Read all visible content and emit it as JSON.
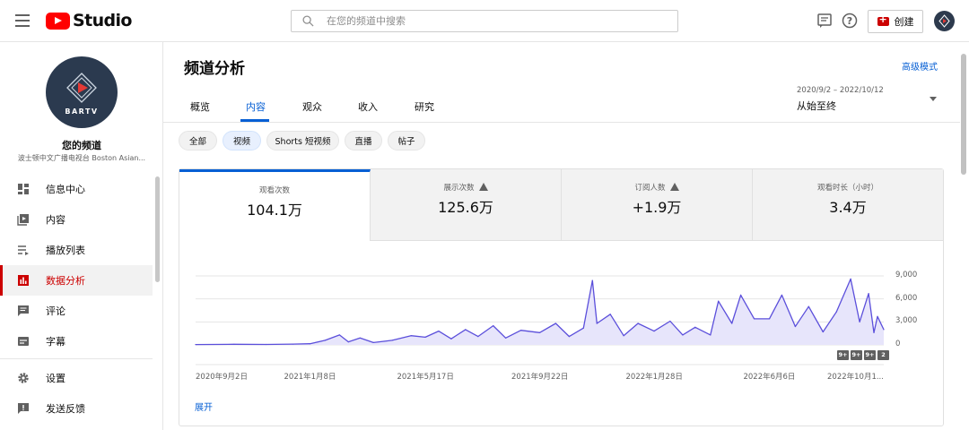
{
  "app": {
    "brand": "Studio",
    "search_placeholder": "在您的频道中搜索",
    "create_label": "创建"
  },
  "sidebar": {
    "channel_title": "您的频道",
    "channel_subtitle": "波士顿中文广播电视台 Boston Asian...",
    "avatar_text": "BARTV",
    "items": [
      {
        "label": "信息中心",
        "icon": "dashboard-icon"
      },
      {
        "label": "内容",
        "icon": "content-icon"
      },
      {
        "label": "播放列表",
        "icon": "playlist-icon"
      },
      {
        "label": "数据分析",
        "icon": "analytics-icon",
        "active": true
      },
      {
        "label": "评论",
        "icon": "comments-icon"
      },
      {
        "label": "字幕",
        "icon": "subtitles-icon"
      },
      {
        "label": "设置",
        "icon": "settings-icon"
      },
      {
        "label": "发送反馈",
        "icon": "feedback-icon"
      }
    ]
  },
  "main": {
    "title": "频道分析",
    "advanced_mode": "高级模式",
    "tabs": [
      {
        "label": "概览"
      },
      {
        "label": "内容",
        "active": true
      },
      {
        "label": "观众"
      },
      {
        "label": "收入"
      },
      {
        "label": "研究"
      }
    ],
    "date_range": "2020/9/2 – 2022/10/12",
    "date_period": "从始至终",
    "chips": [
      {
        "label": "全部"
      },
      {
        "label": "视频",
        "active": true
      },
      {
        "label": "Shorts 短视频"
      },
      {
        "label": "直播"
      },
      {
        "label": "帖子"
      }
    ],
    "metrics": [
      {
        "label": "观看次数",
        "value": "104.1万",
        "warning": false,
        "active": true
      },
      {
        "label": "展示次数",
        "value": "125.6万",
        "warning": true
      },
      {
        "label": "订阅人数",
        "value": "+1.9万",
        "warning": true
      },
      {
        "label": "观看时长（小时）",
        "value": "3.4万",
        "warning": false
      }
    ],
    "expand_label": "展开",
    "badges": [
      "9+",
      "9+",
      "9+",
      "2"
    ]
  },
  "chart_data": {
    "type": "area",
    "series": [
      {
        "name": "观看次数"
      }
    ],
    "color": "#5b4fdb",
    "y_ticks": [
      "9,000",
      "6,000",
      "3,000",
      "0"
    ],
    "ylim": [
      0,
      9000
    ],
    "x_ticks": [
      "2020年9月2日",
      "2021年1月8日",
      "2021年5月17日",
      "2021年9月22日",
      "2022年1月28日",
      "2022年6月6日",
      "2022年10月1..."
    ],
    "x_dates": [
      "2020-09-02",
      "2021-01-08",
      "2021-05-17",
      "2021-09-22",
      "2022-01-28",
      "2022-06-06",
      "2022-10-01"
    ],
    "x_range": [
      "2020-09-02",
      "2022-10-12"
    ],
    "points": [
      [
        "2020-09-02",
        50
      ],
      [
        "2020-10-15",
        80
      ],
      [
        "2020-11-20",
        60
      ],
      [
        "2020-12-20",
        100
      ],
      [
        "2021-01-08",
        150
      ],
      [
        "2021-01-25",
        600
      ],
      [
        "2021-02-10",
        1300
      ],
      [
        "2021-02-20",
        400
      ],
      [
        "2021-03-05",
        900
      ],
      [
        "2021-03-20",
        300
      ],
      [
        "2021-04-10",
        600
      ],
      [
        "2021-05-01",
        1200
      ],
      [
        "2021-05-17",
        1000
      ],
      [
        "2021-06-01",
        1800
      ],
      [
        "2021-06-15",
        800
      ],
      [
        "2021-07-01",
        2000
      ],
      [
        "2021-07-15",
        1100
      ],
      [
        "2021-08-01",
        2500
      ],
      [
        "2021-08-15",
        900
      ],
      [
        "2021-09-01",
        1900
      ],
      [
        "2021-09-22",
        1600
      ],
      [
        "2021-10-10",
        2800
      ],
      [
        "2021-10-25",
        1100
      ],
      [
        "2021-11-10",
        2200
      ],
      [
        "2021-11-20",
        8400
      ],
      [
        "2021-11-25",
        2800
      ],
      [
        "2021-12-10",
        4000
      ],
      [
        "2021-12-25",
        1200
      ],
      [
        "2022-01-10",
        2800
      ],
      [
        "2022-01-28",
        1800
      ],
      [
        "2022-02-15",
        3100
      ],
      [
        "2022-03-01",
        1300
      ],
      [
        "2022-03-15",
        2300
      ],
      [
        "2022-04-01",
        1300
      ],
      [
        "2022-04-10",
        5700
      ],
      [
        "2022-04-25",
        2800
      ],
      [
        "2022-05-05",
        6500
      ],
      [
        "2022-05-20",
        3400
      ],
      [
        "2022-06-06",
        3400
      ],
      [
        "2022-06-20",
        6500
      ],
      [
        "2022-07-05",
        2400
      ],
      [
        "2022-07-20",
        5000
      ],
      [
        "2022-08-05",
        1700
      ],
      [
        "2022-08-20",
        4300
      ],
      [
        "2022-09-05",
        8600
      ],
      [
        "2022-09-15",
        3000
      ],
      [
        "2022-09-25",
        6700
      ],
      [
        "2022-10-01",
        1600
      ],
      [
        "2022-10-05",
        3700
      ],
      [
        "2022-10-12",
        2000
      ]
    ]
  }
}
